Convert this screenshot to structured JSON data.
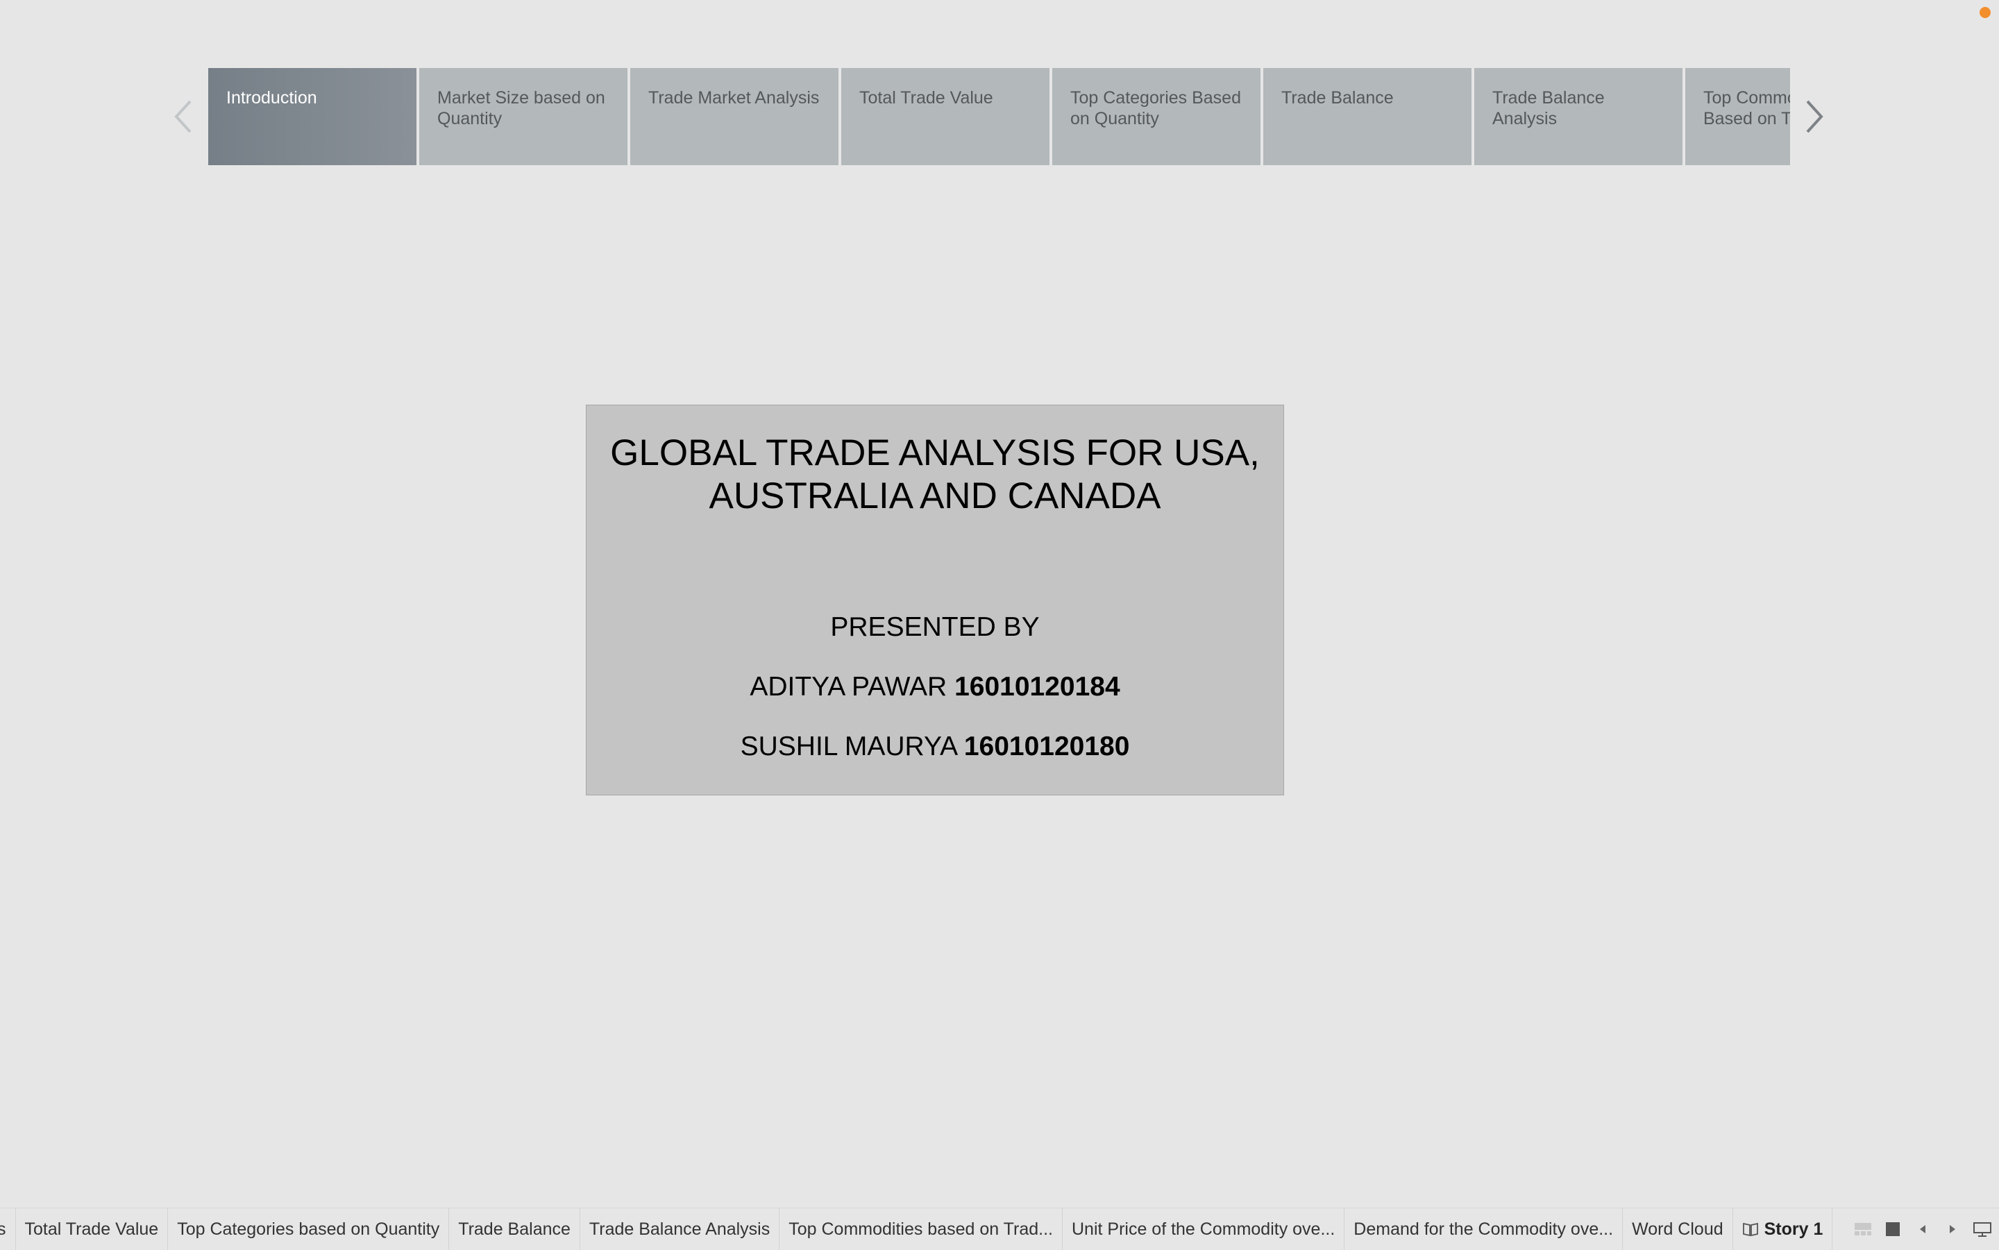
{
  "story": {
    "points": [
      {
        "label": "Introduction",
        "active": true
      },
      {
        "label": "Market Size based on Quantity"
      },
      {
        "label": "Trade Market Analysis"
      },
      {
        "label": "Total Trade Value"
      },
      {
        "label": "Top Categories Based on Quantity"
      },
      {
        "label": "Trade Balance"
      },
      {
        "label": "Trade Balance Analysis"
      },
      {
        "label": "Top Commodities Based on Trade Value"
      }
    ]
  },
  "card": {
    "title": "GLOBAL TRADE ANALYSIS FOR USA, AUSTRALIA AND CANADA",
    "presented_by": "PRESENTED BY",
    "presenters": [
      {
        "name": "ADITYA PAWAR",
        "id": "16010120184"
      },
      {
        "name": "SUSHIL MAURYA",
        "id": "16010120180"
      }
    ]
  },
  "tabs": [
    {
      "label": "s"
    },
    {
      "label": "Total Trade Value"
    },
    {
      "label": "Top Categories based on Quantity"
    },
    {
      "label": "Trade Balance"
    },
    {
      "label": "Trade Balance Analysis"
    },
    {
      "label": "Top Commodities based on Trad..."
    },
    {
      "label": "Unit Price of the Commodity ove..."
    },
    {
      "label": "Demand for the Commodity ove..."
    },
    {
      "label": "Word Cloud"
    },
    {
      "label": "Story 1",
      "active": true
    }
  ],
  "colors": {
    "accent_dot": "#f28e2b",
    "active_point": "#7b848b",
    "inactive_point": "#b3b8ba",
    "card_bg": "#c4c4c4"
  }
}
